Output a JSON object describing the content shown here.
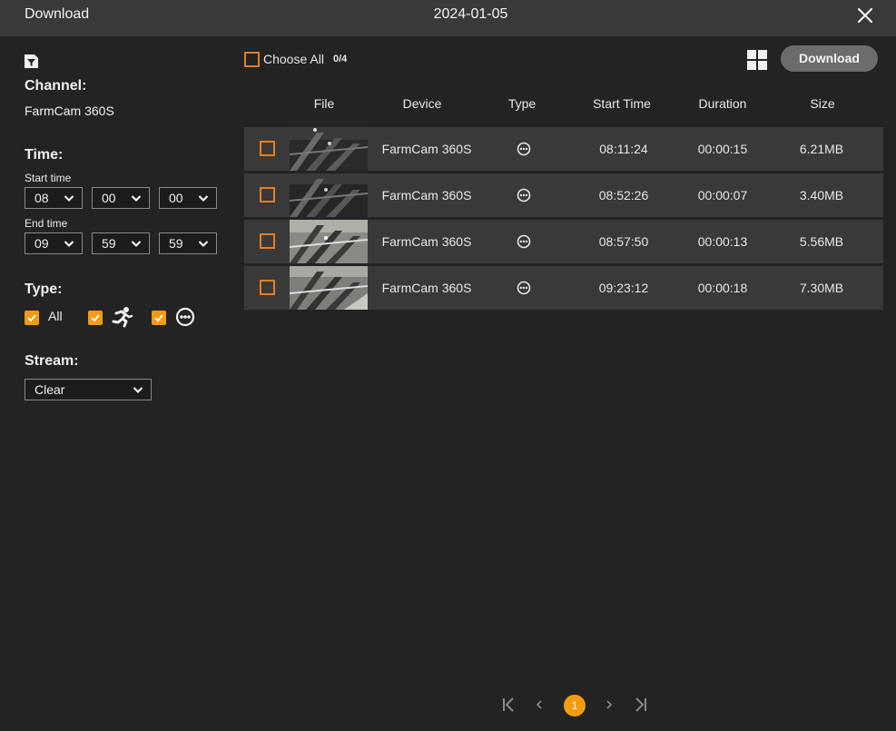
{
  "window": {
    "title": "Download",
    "date": "2024-01-05"
  },
  "sidebar": {
    "channel": {
      "label": "Channel:",
      "value": "FarmCam 360S"
    },
    "time": {
      "label": "Time:",
      "start_label": "Start time",
      "start": [
        "08",
        "00",
        "00"
      ],
      "end_label": "End time",
      "end": [
        "09",
        "59",
        "59"
      ]
    },
    "type": {
      "label": "Type:",
      "options": [
        {
          "label": "All",
          "checked": true
        },
        {
          "icon": "running-person-icon",
          "checked": true
        },
        {
          "icon": "more-circle-icon",
          "checked": true
        }
      ]
    },
    "stream": {
      "label": "Stream:",
      "value": "Clear"
    }
  },
  "toolbar": {
    "choose_all": "Choose All",
    "count": "0/4",
    "download": "Download"
  },
  "table": {
    "headers": [
      "File",
      "Device",
      "Type",
      "Start Time",
      "Duration",
      "Size"
    ],
    "rows": [
      {
        "device": "FarmCam 360S",
        "type_icon": "more-circle-icon",
        "start_time": "08:11:24",
        "duration": "00:00:15",
        "size": "6.21MB"
      },
      {
        "device": "FarmCam 360S",
        "type_icon": "more-circle-icon",
        "start_time": "08:52:26",
        "duration": "00:00:07",
        "size": "3.40MB"
      },
      {
        "device": "FarmCam 360S",
        "type_icon": "more-circle-icon",
        "start_time": "08:57:50",
        "duration": "00:00:13",
        "size": "5.56MB"
      },
      {
        "device": "FarmCam 360S",
        "type_icon": "more-circle-icon",
        "start_time": "09:23:12",
        "duration": "00:00:18",
        "size": "7.30MB"
      }
    ]
  },
  "pagination": {
    "current": "1"
  },
  "colors": {
    "accent": "#f39c12",
    "background": "#232323",
    "titlebar": "#393939",
    "row": "#393939"
  }
}
